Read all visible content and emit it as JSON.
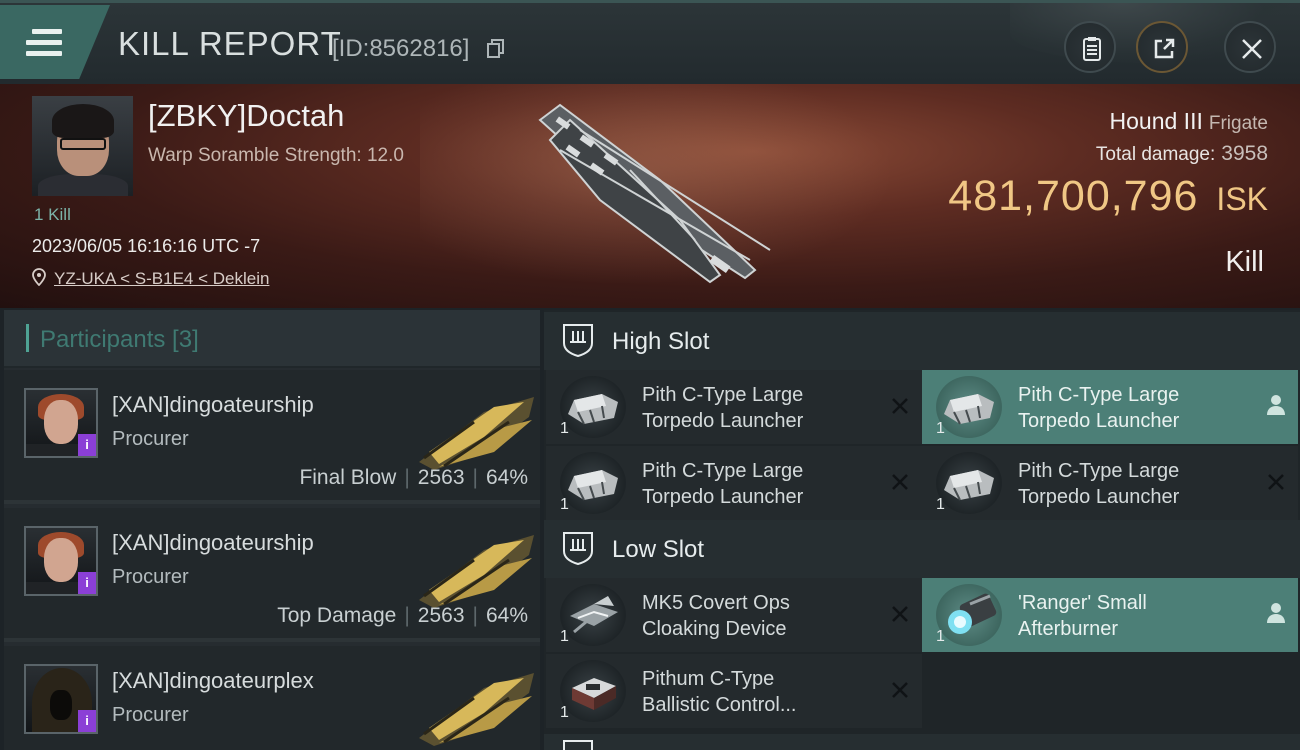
{
  "header": {
    "title": "KILL REPORT",
    "report_id": "[ID:8562816]"
  },
  "victim": {
    "name": "[ZBKY]Doctah",
    "warp_scramble": "Warp Soramble Strength: 12.0",
    "kill_count": "1 Kill",
    "timestamp": "2023/06/05 16:16:16 UTC -7",
    "location": "YZ-UKA < S-B1E4 < Deklein",
    "ship_name": "Hound III",
    "ship_class": "Frigate",
    "total_damage_label": "Total damage:",
    "total_damage": "3958",
    "isk_value": "481,700,796",
    "isk_unit": "ISK",
    "report_type": "Kill"
  },
  "participants": {
    "header": "Participants [3]",
    "items": [
      {
        "name": "[XAN]dingoateurship",
        "ship": "Procurer",
        "role": "Final Blow",
        "damage": "2563",
        "percent": "64%"
      },
      {
        "name": "[XAN]dingoateurship",
        "ship": "Procurer",
        "role": "Top Damage",
        "damage": "2563",
        "percent": "64%"
      },
      {
        "name": "[XAN]dingoateurplex",
        "ship": "Procurer",
        "role": "",
        "damage": "",
        "percent": ""
      }
    ]
  },
  "slots": {
    "high": {
      "title": "High Slot",
      "items": [
        {
          "line1": "Pith C-Type Large",
          "line2": "Torpedo Launcher",
          "qty": "1",
          "status": "destroyed"
        },
        {
          "line1": "Pith C-Type Large",
          "line2": "Torpedo Launcher",
          "qty": "1",
          "status": "dropped"
        },
        {
          "line1": "Pith C-Type Large",
          "line2": "Torpedo Launcher",
          "qty": "1",
          "status": "destroyed"
        },
        {
          "line1": "Pith C-Type Large",
          "line2": "Torpedo Launcher",
          "qty": "1",
          "status": "destroyed"
        }
      ]
    },
    "low": {
      "title": "Low Slot",
      "items": [
        {
          "line1": "MK5 Covert Ops",
          "line2": "Cloaking Device",
          "qty": "1",
          "status": "destroyed"
        },
        {
          "line1": "'Ranger' Small",
          "line2": "Afterburner",
          "qty": "1",
          "status": "dropped"
        },
        {
          "line1": "Pithum C-Type",
          "line2": "Ballistic Control...",
          "qty": "1",
          "status": "destroyed"
        }
      ]
    }
  },
  "colors": {
    "accent": "#4fa394",
    "isk_gold": "#f0c785",
    "dropped_slot": "#4c7f77",
    "badge_purple": "#8b3fd6"
  },
  "icons": [
    "menu-icon",
    "copy-icon",
    "clipboard-icon",
    "share-icon",
    "close-icon",
    "location-pin-icon",
    "slot-rack-icon",
    "x-icon",
    "person-icon"
  ]
}
